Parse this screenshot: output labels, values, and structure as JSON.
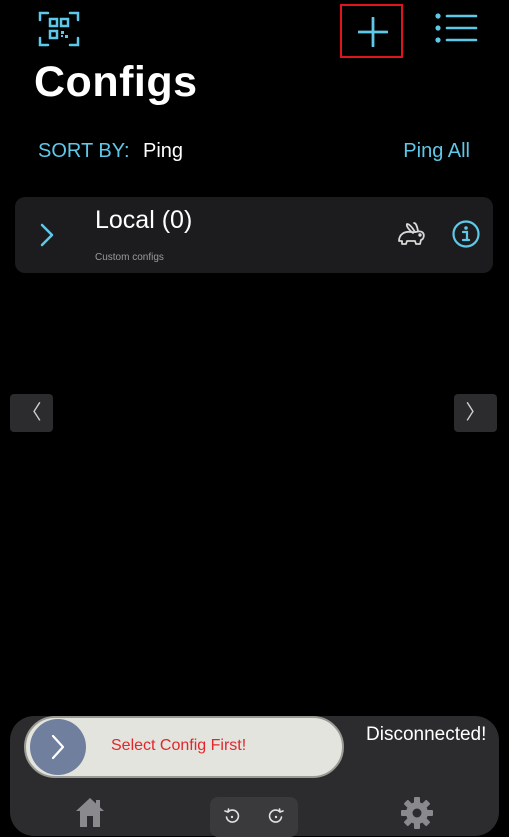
{
  "header": {
    "title": "Configs",
    "qr_icon": "qr-scan-icon",
    "add_icon": "plus-icon",
    "menu_icon": "list-menu-icon"
  },
  "sort": {
    "label": "SORT BY:",
    "value": "Ping",
    "ping_all_label": "Ping All"
  },
  "configs": [
    {
      "title": "Local (0)",
      "subtitle": "Custom configs",
      "expand_icon": "chevron-right-icon",
      "speed_icon": "rabbit-icon",
      "info_icon": "info-icon"
    }
  ],
  "pager": {
    "prev_glyph": "〈",
    "next_glyph": "〉"
  },
  "connection": {
    "slider_text": "Select Config First!",
    "status": "Disconnected!"
  },
  "tabs": [
    {
      "icon": "home-icon"
    },
    {
      "icon": "undo-redo-icon"
    },
    {
      "icon": "gear-icon"
    }
  ],
  "colors": {
    "accent": "#5ec8e8",
    "warning_text": "#e3262b",
    "highlight_box": "#e0141c",
    "card_bg": "#1c1c1e",
    "panel_bg": "#2c2c2e"
  }
}
